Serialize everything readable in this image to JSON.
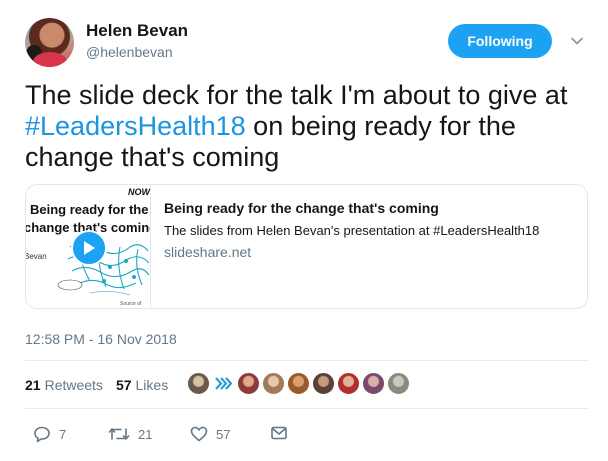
{
  "user": {
    "name": "Helen Bevan",
    "handle": "@helenbevan",
    "follow_label": "Following"
  },
  "tweet": {
    "text_before": "The slide deck for the talk I'm about to give at ",
    "hashtag": "#LeadersHealth18",
    "text_after": " on being ready for the change that's coming"
  },
  "card": {
    "thumbnail": {
      "line1": "Being ready for the",
      "line2": "change that's coming",
      "corner": "NOW",
      "presenter": "Bevan",
      "source": "Source of image"
    },
    "title": "Being ready for the change that's coming",
    "description": "The slides from Helen Bevan's presentation at #LeadersHealth18",
    "domain": "slideshare.net"
  },
  "timestamp": "12:58 PM - 16 Nov 2018",
  "stats": {
    "retweets_count": "21",
    "retweets_label": "Retweets",
    "likes_count": "57",
    "likes_label": "Likes"
  },
  "likers": [
    {
      "icon": "avatar",
      "color": "#6b5a4a"
    },
    {
      "icon": "arrows-logo",
      "color": "#2aa0c8"
    },
    {
      "icon": "avatar",
      "color": "#8c3a3a"
    },
    {
      "icon": "avatar",
      "color": "#a07a5a"
    },
    {
      "icon": "avatar",
      "color": "#9a5a2a"
    },
    {
      "icon": "avatar",
      "color": "#5a4036"
    },
    {
      "icon": "avatar",
      "color": "#b03030"
    },
    {
      "icon": "avatar",
      "color": "#7a4a6a"
    },
    {
      "icon": "avatar",
      "color": "#8a8a80"
    }
  ],
  "actions": {
    "replies": "7",
    "retweets": "21",
    "likes": "57"
  },
  "colors": {
    "accent": "#1da1f2",
    "hashtag": "#1b95e0",
    "secondary_text": "#657786"
  }
}
